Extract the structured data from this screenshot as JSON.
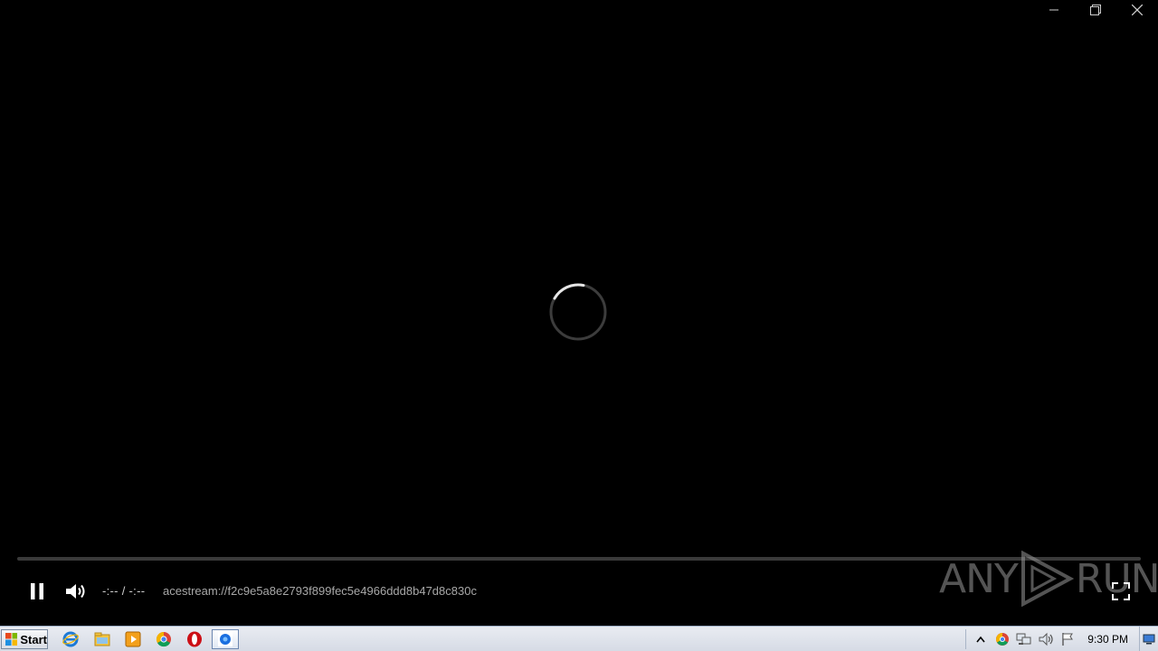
{
  "window": {
    "controls": [
      "minimize",
      "restore",
      "close"
    ]
  },
  "player": {
    "time_display": "-:-- / -:--",
    "media_title": "acestream://f2c9e5a8e2793f899fec5e4966ddd8b47d8c830c",
    "progress": 0,
    "state": "loading",
    "icons": [
      "pause-icon",
      "volume-icon",
      "fullscreen-icon",
      "loading-spinner"
    ]
  },
  "watermark": {
    "text_left": "ANY",
    "text_right": "RUN"
  },
  "taskbar": {
    "start_label": "Start",
    "pinned": [
      "internet-explorer-icon",
      "file-explorer-icon",
      "media-player-icon",
      "chrome-icon",
      "opera-icon",
      "acestream-icon"
    ],
    "active_app": "acestream-icon",
    "tray_icons": [
      "show-hidden-icons-icon",
      "chrome-tray-icon",
      "network-icon",
      "volume-tray-icon",
      "action-center-flag-icon"
    ],
    "clock": "9:30 PM"
  },
  "colors": {
    "background": "#000000",
    "control_text": "#cfcfcf",
    "title_text": "#a8a8a8",
    "taskbar": "#dfe3ea"
  }
}
